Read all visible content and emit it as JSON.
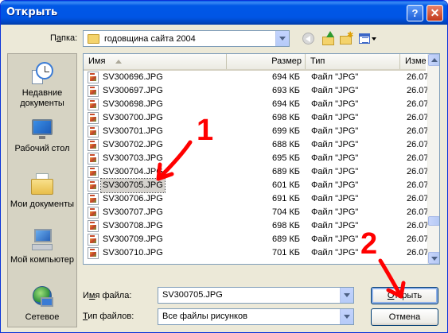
{
  "window": {
    "title": "Открыть",
    "help_glyph": "?",
    "close_glyph": "✕"
  },
  "lookin": {
    "label_prefix": "П",
    "label_ul": "а",
    "label_rest": "пка:",
    "value": "годовщина сайта 2004"
  },
  "places": [
    {
      "icon": "recent-documents-icon",
      "label": "Недавние документы"
    },
    {
      "icon": "desktop-icon",
      "label": "Рабочий стол"
    },
    {
      "icon": "my-documents-icon",
      "label": "Мои документы"
    },
    {
      "icon": "my-computer-icon",
      "label": "Мой компьютер"
    },
    {
      "icon": "network-places-icon",
      "label": "Сетевое"
    }
  ],
  "columns": {
    "name": "Имя",
    "size": "Размер",
    "type": "Тип",
    "modified": "Измe"
  },
  "files": [
    {
      "name": "SV300696.JPG",
      "size": "694 КБ",
      "type": "Файл \"JPG\"",
      "date": "26.07"
    },
    {
      "name": "SV300697.JPG",
      "size": "693 КБ",
      "type": "Файл \"JPG\"",
      "date": "26.07"
    },
    {
      "name": "SV300698.JPG",
      "size": "694 КБ",
      "type": "Файл \"JPG\"",
      "date": "26.07"
    },
    {
      "name": "SV300700.JPG",
      "size": "698 КБ",
      "type": "Файл \"JPG\"",
      "date": "26.07"
    },
    {
      "name": "SV300701.JPG",
      "size": "699 КБ",
      "type": "Файл \"JPG\"",
      "date": "26.07"
    },
    {
      "name": "SV300702.JPG",
      "size": "688 КБ",
      "type": "Файл \"JPG\"",
      "date": "26.07"
    },
    {
      "name": "SV300703.JPG",
      "size": "695 КБ",
      "type": "Файл \"JPG\"",
      "date": "26.07"
    },
    {
      "name": "SV300704.JPG",
      "size": "689 КБ",
      "type": "Файл \"JPG\"",
      "date": "26.07"
    },
    {
      "name": "SV300705.JPG",
      "size": "601 КБ",
      "type": "Файл \"JPG\"",
      "date": "26.07",
      "selected": true
    },
    {
      "name": "SV300706.JPG",
      "size": "691 КБ",
      "type": "Файл \"JPG\"",
      "date": "26.07"
    },
    {
      "name": "SV300707.JPG",
      "size": "704 КБ",
      "type": "Файл \"JPG\"",
      "date": "26.07"
    },
    {
      "name": "SV300708.JPG",
      "size": "698 КБ",
      "type": "Файл \"JPG\"",
      "date": "26.07"
    },
    {
      "name": "SV300709.JPG",
      "size": "689 КБ",
      "type": "Файл \"JPG\"",
      "date": "26.07"
    },
    {
      "name": "SV300710.JPG",
      "size": "701 КБ",
      "type": "Файл \"JPG\"",
      "date": "26.07"
    }
  ],
  "filename": {
    "label_prefix": "И",
    "label_ul": "м",
    "label_rest": "я файла:",
    "value": "SV300705.JPG"
  },
  "filetype": {
    "label_prefix": "",
    "label_ul": "Т",
    "label_rest": "ип файлов:",
    "value": "Все файлы рисунков"
  },
  "buttons": {
    "open_ul": "О",
    "open_rest": "ткрыть",
    "cancel": "Отмена"
  },
  "annotations": {
    "mark1": "1",
    "mark2": "2",
    "color": "#ff0000"
  }
}
